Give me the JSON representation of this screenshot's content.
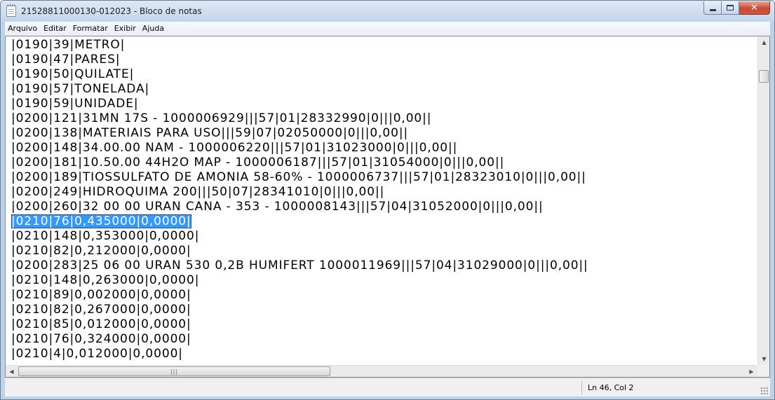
{
  "window": {
    "title": "21528811000130-012023 - Bloco de notas",
    "icon": "notepad-icon"
  },
  "menu": [
    "Arquivo",
    "Editar",
    "Formatar",
    "Exibir",
    "Ajuda"
  ],
  "document": {
    "lines": [
      "|0190|39|METRO|",
      "|0190|47|PARES|",
      "|0190|50|QUILATE|",
      "|0190|57|TONELADA|",
      "|0190|59|UNIDADE|",
      "|0200|121|31MN 17S - 1000006929|||57|01|28332990|0|||0,00||",
      "|0200|138|MATERIAIS PARA USO|||59|07|02050000|0|||0,00||",
      "|0200|148|34.00.00 NAM - 1000006220|||57|01|31023000|0|||0,00||",
      "|0200|181|10.50.00 44H2O MAP - 1000006187|||57|01|31054000|0|||0,00||",
      "|0200|189|TIOSSULFATO DE AMONIA 58-60% - 1000006737|||57|01|28323010|0|||0,00||",
      "|0200|249|HIDROQUIMA 200|||50|07|28341010|0|||0,00||",
      "|0200|260|32 00 00 URAN CANA - 353 - 1000008143|||57|04|31052000|0|||0,00||",
      "|0210|76|0,435000|0,0000|",
      "|0210|148|0,353000|0,0000|",
      "|0210|82|0,212000|0,0000|",
      "|0200|283|25 06 00 URAN 530 0,2B HUMIFERT 1000011969|||57|04|31029000|0|||0,00||",
      "|0210|148|0,263000|0,0000|",
      "|0210|89|0,002000|0,0000|",
      "|0210|82|0,267000|0,0000|",
      "|0210|85|0,012000|0,0000|",
      "|0210|76|0,324000|0,0000|",
      "|0210|4|0,012000|0,0000|"
    ],
    "selected_line_index": 12,
    "selection_color": "#3399ff"
  },
  "status": {
    "position": "Ln 46, Col 2"
  }
}
